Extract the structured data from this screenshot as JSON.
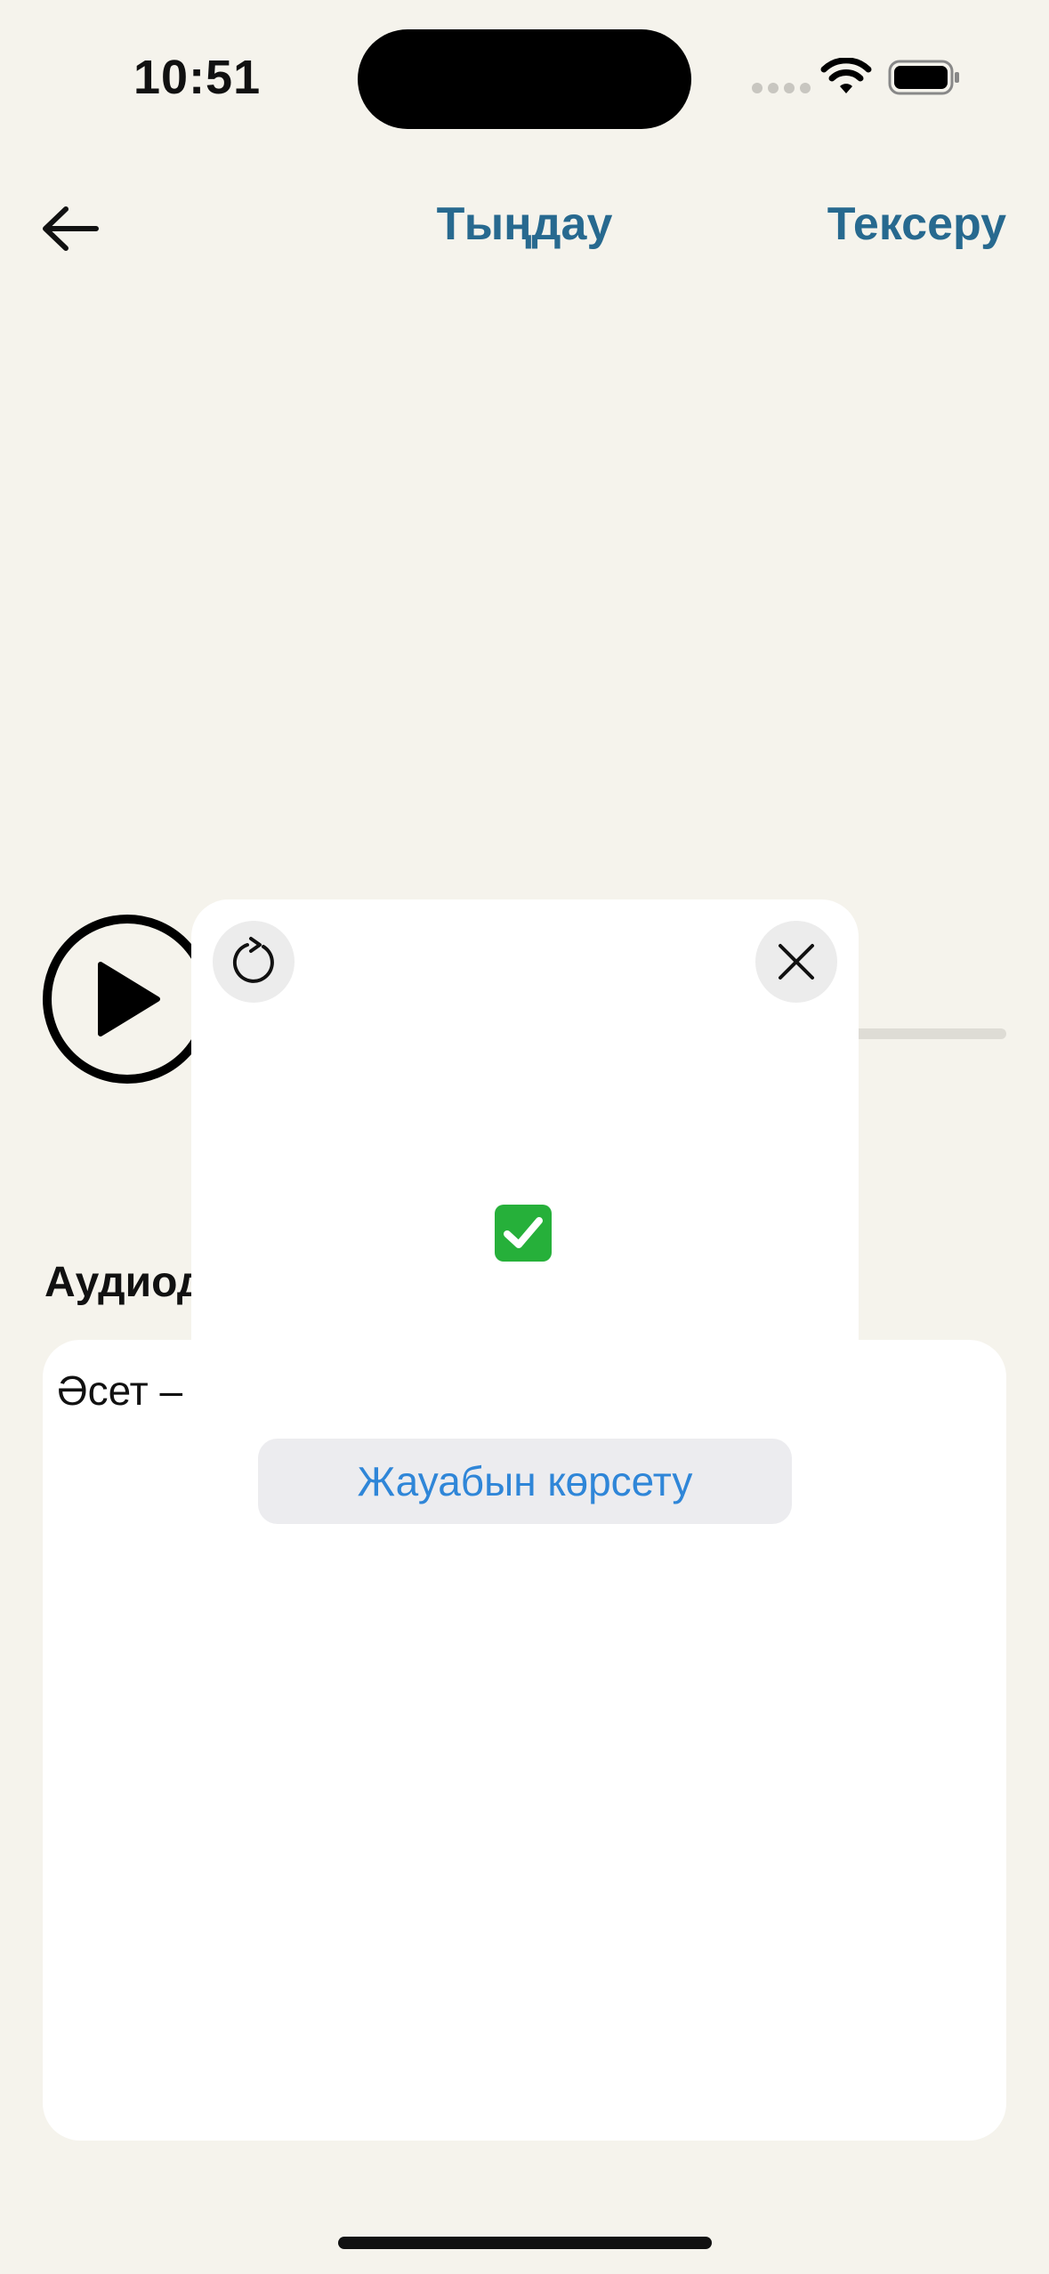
{
  "status_bar": {
    "time": "10:51"
  },
  "header": {
    "title": "Тыңдау",
    "check_label": "Тексеру",
    "back_icon": "arrow-left-icon"
  },
  "player": {
    "play_icon": "play-icon",
    "progress": 0
  },
  "transcript": {
    "section_title": "Аудиод",
    "text": "Әсет –"
  },
  "popup": {
    "retry_icon": "refresh-icon",
    "close_icon": "close-icon",
    "result_icon": "check-mark-button-icon",
    "show_answer_label": "Жауабын көрсету"
  },
  "colors": {
    "background": "#f5f3ec",
    "accent": "#27698f",
    "link": "#2f86d8",
    "success": "#26b03a"
  }
}
